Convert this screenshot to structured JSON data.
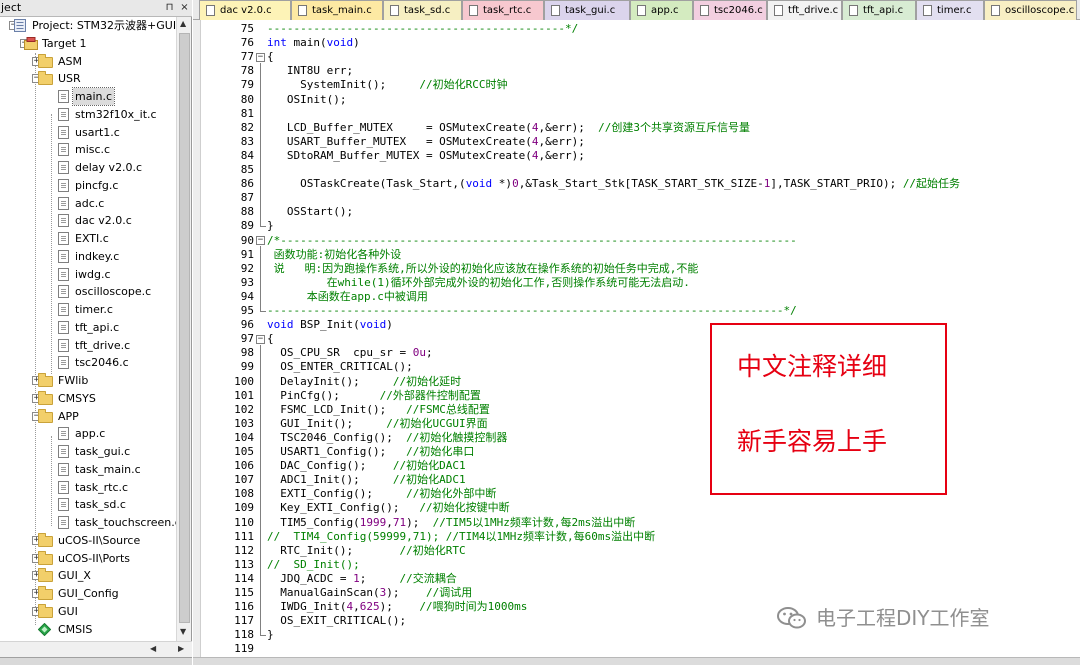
{
  "project_panel": {
    "title": "ject",
    "pin_glyph": "⊓",
    "close_glyph": "×",
    "tree": [
      {
        "label": "Project: STM32示波器+GUI",
        "depth": 0,
        "kind": "project",
        "expander": "−"
      },
      {
        "label": "Target 1",
        "depth": 1,
        "kind": "target",
        "expander": "−"
      },
      {
        "label": "ASM",
        "depth": 2,
        "kind": "folder",
        "expander": "+"
      },
      {
        "label": "USR",
        "depth": 2,
        "kind": "folder",
        "expander": "−"
      },
      {
        "label": "main.c",
        "depth": 3,
        "kind": "file",
        "selected": true
      },
      {
        "label": "stm32f10x_it.c",
        "depth": 3,
        "kind": "file"
      },
      {
        "label": "usart1.c",
        "depth": 3,
        "kind": "file"
      },
      {
        "label": "misc.c",
        "depth": 3,
        "kind": "file"
      },
      {
        "label": "delay v2.0.c",
        "depth": 3,
        "kind": "file"
      },
      {
        "label": "pincfg.c",
        "depth": 3,
        "kind": "file"
      },
      {
        "label": "adc.c",
        "depth": 3,
        "kind": "file"
      },
      {
        "label": "dac v2.0.c",
        "depth": 3,
        "kind": "file"
      },
      {
        "label": "EXTI.c",
        "depth": 3,
        "kind": "file"
      },
      {
        "label": "indkey.c",
        "depth": 3,
        "kind": "file"
      },
      {
        "label": "iwdg.c",
        "depth": 3,
        "kind": "file"
      },
      {
        "label": "oscilloscope.c",
        "depth": 3,
        "kind": "file"
      },
      {
        "label": "timer.c",
        "depth": 3,
        "kind": "file"
      },
      {
        "label": "tft_api.c",
        "depth": 3,
        "kind": "file"
      },
      {
        "label": "tft_drive.c",
        "depth": 3,
        "kind": "file"
      },
      {
        "label": "tsc2046.c",
        "depth": 3,
        "kind": "file"
      },
      {
        "label": "FWlib",
        "depth": 2,
        "kind": "folder",
        "expander": "+"
      },
      {
        "label": "CMSYS",
        "depth": 2,
        "kind": "folder",
        "expander": "+"
      },
      {
        "label": "APP",
        "depth": 2,
        "kind": "folder",
        "expander": "−"
      },
      {
        "label": "app.c",
        "depth": 3,
        "kind": "file"
      },
      {
        "label": "task_gui.c",
        "depth": 3,
        "kind": "file"
      },
      {
        "label": "task_main.c",
        "depth": 3,
        "kind": "file"
      },
      {
        "label": "task_rtc.c",
        "depth": 3,
        "kind": "file"
      },
      {
        "label": "task_sd.c",
        "depth": 3,
        "kind": "file"
      },
      {
        "label": "task_touchscreen.c",
        "depth": 3,
        "kind": "file"
      },
      {
        "label": "uCOS-II\\Source",
        "depth": 2,
        "kind": "folder",
        "expander": "+"
      },
      {
        "label": "uCOS-II\\Ports",
        "depth": 2,
        "kind": "folder",
        "expander": "+"
      },
      {
        "label": "GUI_X",
        "depth": 2,
        "kind": "folder",
        "expander": "+"
      },
      {
        "label": "GUI_Config",
        "depth": 2,
        "kind": "folder",
        "expander": "+"
      },
      {
        "label": "GUI",
        "depth": 2,
        "kind": "folder",
        "expander": "+"
      },
      {
        "label": "CMSIS",
        "depth": 2,
        "kind": "gem"
      }
    ]
  },
  "tabs": [
    {
      "label": "dac v2.0.c",
      "color": "#fdf3b7",
      "active": false
    },
    {
      "label": "task_main.c",
      "color": "#fde9a3",
      "active": false
    },
    {
      "label": "task_sd.c",
      "color": "#f6efc2",
      "active": false
    },
    {
      "label": "task_rtc.c",
      "color": "#f7c8cf",
      "active": false
    },
    {
      "label": "task_gui.c",
      "color": "#dbd4ec",
      "active": false
    },
    {
      "label": "app.c",
      "color": "#d4ebc0",
      "active": false
    },
    {
      "label": "tsc2046.c",
      "color": "#f2cfe0",
      "active": false
    },
    {
      "label": "tft_drive.c",
      "color": "#f2f2f2",
      "active": false
    },
    {
      "label": "tft_api.c",
      "color": "#d8ecd3",
      "active": false
    },
    {
      "label": "timer.c",
      "color": "#e2dff0",
      "active": false
    },
    {
      "label": "oscilloscope.c",
      "color": "#f8efc4",
      "active": false
    }
  ],
  "editor": {
    "lines": [
      {
        "n": "75",
        "segs": [
          [
            "cm",
            "---------------------------------------------*/"
          ]
        ]
      },
      {
        "n": "76",
        "segs": [
          [
            "kw",
            "int"
          ],
          [
            "",
            " main("
          ],
          [
            "kw",
            "void"
          ],
          [
            "",
            ")"
          ]
        ]
      },
      {
        "n": "77",
        "segs": [
          [
            "",
            "{"
          ]
        ]
      },
      {
        "n": "78",
        "segs": [
          [
            "",
            "   INT8U err;"
          ]
        ]
      },
      {
        "n": "79",
        "segs": [
          [
            "",
            "     SystemInit();     "
          ],
          [
            "cm",
            "//初始化RCC时钟"
          ]
        ]
      },
      {
        "n": "80",
        "segs": [
          [
            "",
            "   OSInit();"
          ]
        ]
      },
      {
        "n": "81",
        "segs": [
          [
            "",
            ""
          ]
        ]
      },
      {
        "n": "82",
        "segs": [
          [
            "",
            "   LCD_Buffer_MUTEX     = OSMutexCreate("
          ],
          [
            "num",
            "4"
          ],
          [
            "",
            ",&err);  "
          ],
          [
            "cm",
            "//创建3个共享资源互斥信号量"
          ]
        ]
      },
      {
        "n": "83",
        "segs": [
          [
            "",
            "   USART_Buffer_MUTEX   = OSMutexCreate("
          ],
          [
            "num",
            "4"
          ],
          [
            "",
            ",&err);"
          ]
        ]
      },
      {
        "n": "84",
        "segs": [
          [
            "",
            "   SDtoRAM_Buffer_MUTEX = OSMutexCreate("
          ],
          [
            "num",
            "4"
          ],
          [
            "",
            ",&err);"
          ]
        ]
      },
      {
        "n": "85",
        "segs": [
          [
            "",
            ""
          ]
        ]
      },
      {
        "n": "86",
        "segs": [
          [
            "",
            "     OSTaskCreate(Task_Start,("
          ],
          [
            "kw",
            "void"
          ],
          [
            "",
            " *)"
          ],
          [
            "num",
            "0"
          ],
          [
            "",
            ",&Task_Start_Stk[TASK_START_STK_SIZE-"
          ],
          [
            "num",
            "1"
          ],
          [
            "",
            "],TASK_START_PRIO); "
          ],
          [
            "cm",
            "//起始任务"
          ]
        ]
      },
      {
        "n": "87",
        "segs": [
          [
            "",
            ""
          ]
        ]
      },
      {
        "n": "88",
        "segs": [
          [
            "",
            "   OSStart();"
          ]
        ]
      },
      {
        "n": "89",
        "segs": [
          [
            "",
            "}"
          ]
        ]
      },
      {
        "n": "90",
        "segs": [
          [
            "cm",
            "/*------------------------------------------------------------------------------"
          ]
        ]
      },
      {
        "n": "91",
        "segs": [
          [
            "cm",
            " 函数功能:初始化各种外设"
          ]
        ]
      },
      {
        "n": "92",
        "segs": [
          [
            "cm",
            " 说   明:因为跑操作系统,所以外设的初始化应该放在操作系统的初始任务中完成,不能"
          ]
        ]
      },
      {
        "n": "93",
        "segs": [
          [
            "cm",
            "         在while(1)循环外部完成外设的初始化工作,否则操作系统可能无法启动."
          ]
        ]
      },
      {
        "n": "94",
        "segs": [
          [
            "cm",
            "      本函数在app.c中被调用"
          ]
        ]
      },
      {
        "n": "95",
        "segs": [
          [
            "cm",
            "------------------------------------------------------------------------------*/"
          ]
        ]
      },
      {
        "n": "96",
        "segs": [
          [
            "kw",
            "void"
          ],
          [
            "",
            " BSP_Init("
          ],
          [
            "kw",
            "void"
          ],
          [
            "",
            ")"
          ]
        ]
      },
      {
        "n": "97",
        "segs": [
          [
            "",
            "{"
          ]
        ]
      },
      {
        "n": "98",
        "segs": [
          [
            "",
            "  OS_CPU_SR  cpu_sr = "
          ],
          [
            "num",
            "0u"
          ],
          [
            "",
            ";"
          ]
        ]
      },
      {
        "n": "99",
        "segs": [
          [
            "",
            "  OS_ENTER_CRITICAL();"
          ]
        ]
      },
      {
        "n": "100",
        "segs": [
          [
            "",
            "  DelayInit();     "
          ],
          [
            "cm",
            "//初始化延时"
          ]
        ]
      },
      {
        "n": "101",
        "segs": [
          [
            "",
            "  PinCfg();      "
          ],
          [
            "cm",
            "//外部器件控制配置"
          ]
        ]
      },
      {
        "n": "102",
        "segs": [
          [
            "",
            "  FSMC_LCD_Init();   "
          ],
          [
            "cm",
            "//FSMC总线配置"
          ]
        ]
      },
      {
        "n": "103",
        "segs": [
          [
            "",
            "  GUI_Init();     "
          ],
          [
            "cm",
            "//初始化UCGUI界面"
          ]
        ]
      },
      {
        "n": "104",
        "segs": [
          [
            "",
            "  TSC2046_Config();  "
          ],
          [
            "cm",
            "//初始化触摸控制器"
          ]
        ]
      },
      {
        "n": "105",
        "segs": [
          [
            "",
            "  USART1_Config();   "
          ],
          [
            "cm",
            "//初始化串口"
          ]
        ]
      },
      {
        "n": "106",
        "segs": [
          [
            "",
            "  DAC_Config();    "
          ],
          [
            "cm",
            "//初始化DAC1"
          ]
        ]
      },
      {
        "n": "107",
        "segs": [
          [
            "",
            "  ADC1_Init();     "
          ],
          [
            "cm",
            "//初始化ADC1"
          ]
        ]
      },
      {
        "n": "108",
        "segs": [
          [
            "",
            "  EXTI_Config();     "
          ],
          [
            "cm",
            "//初始化外部中断"
          ]
        ]
      },
      {
        "n": "109",
        "segs": [
          [
            "",
            "  Key_EXTI_Config();   "
          ],
          [
            "cm",
            "//初始化按键中断"
          ]
        ]
      },
      {
        "n": "110",
        "segs": [
          [
            "",
            "  TIM5_Config("
          ],
          [
            "num",
            "1999"
          ],
          [
            "",
            ","
          ],
          [
            "num",
            "71"
          ],
          [
            "",
            ");  "
          ],
          [
            "cm",
            "//TIM5以1MHz频率计数,每2ms溢出中断"
          ]
        ]
      },
      {
        "n": "111",
        "segs": [
          [
            "cm",
            "//  TIM4_Config(59999,71); //TIM4以1MHz频率计数,每60ms溢出中断"
          ]
        ]
      },
      {
        "n": "112",
        "segs": [
          [
            "",
            "  RTC_Init();       "
          ],
          [
            "cm",
            "//初始化RTC"
          ]
        ]
      },
      {
        "n": "113",
        "segs": [
          [
            "cm",
            "//  SD_Init();"
          ]
        ]
      },
      {
        "n": "114",
        "segs": [
          [
            "",
            "  JDQ_ACDC = "
          ],
          [
            "num",
            "1"
          ],
          [
            "",
            ";     "
          ],
          [
            "cm",
            "//交流耦合"
          ]
        ]
      },
      {
        "n": "115",
        "segs": [
          [
            "",
            "  ManualGainScan("
          ],
          [
            "num",
            "3"
          ],
          [
            "",
            ");    "
          ],
          [
            "cm",
            "//调试用"
          ]
        ]
      },
      {
        "n": "116",
        "segs": [
          [
            "",
            "  IWDG_Init("
          ],
          [
            "num",
            "4"
          ],
          [
            "",
            ","
          ],
          [
            "num",
            "625"
          ],
          [
            "",
            ");    "
          ],
          [
            "cm",
            "//喂狗时间为1000ms"
          ]
        ]
      },
      {
        "n": "117",
        "segs": [
          [
            "",
            "  OS_EXIT_CRITICAL();"
          ]
        ]
      },
      {
        "n": "118",
        "segs": [
          [
            "",
            "}"
          ]
        ]
      },
      {
        "n": "119",
        "segs": [
          [
            "",
            ""
          ]
        ]
      }
    ]
  },
  "annotation": {
    "line1": "中文注释详细",
    "line2": "新手容易上手",
    "border_color": "#e60012"
  },
  "watermark": {
    "icon": "wechat-icon",
    "text": "电子工程DIY工作室"
  },
  "colors": {
    "keyword": "#0000ff",
    "comment": "#008000",
    "number": "#800080"
  }
}
